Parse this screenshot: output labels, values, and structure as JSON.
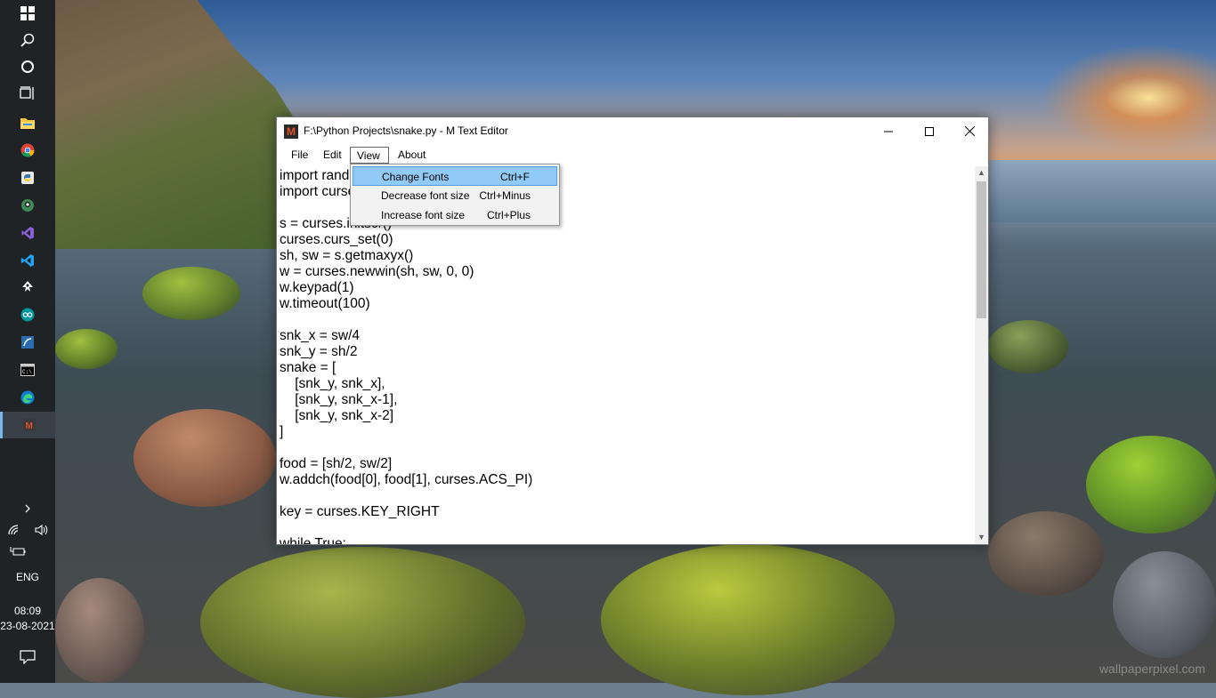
{
  "window": {
    "title": "F:\\Python Projects\\snake.py - M Text Editor",
    "app_icon_letter": "M"
  },
  "menubar": {
    "file": "File",
    "edit": "Edit",
    "view": "View",
    "about": "About"
  },
  "view_menu": [
    {
      "label": "Change Fonts",
      "shortcut": "Ctrl+F",
      "highlighted": true
    },
    {
      "label": "Decrease font size",
      "shortcut": "Ctrl+Minus",
      "highlighted": false
    },
    {
      "label": "Increase font size",
      "shortcut": "Ctrl+Plus",
      "highlighted": false
    }
  ],
  "editor": {
    "lines": [
      "import rand",
      "import curse",
      "",
      "s = curses.initscr()",
      "curses.curs_set(0)",
      "sh, sw = s.getmaxyx()",
      "w = curses.newwin(sh, sw, 0, 0)",
      "w.keypad(1)",
      "w.timeout(100)",
      "",
      "snk_x = sw/4",
      "snk_y = sh/2",
      "snake = [",
      "    [snk_y, snk_x],",
      "    [snk_y, snk_x-1],",
      "    [snk_y, snk_x-2]",
      "]",
      "",
      "food = [sh/2, sw/2]",
      "w.addch(food[0], food[1], curses.ACS_PI)",
      "",
      "key = curses.KEY_RIGHT",
      "",
      "while True:"
    ]
  },
  "taskbar": {
    "language": "ENG",
    "time": "08:09",
    "date": "23-08-2021",
    "icons": [
      "windows-start-icon",
      "search-icon",
      "cortana-icon",
      "task-view-icon",
      "file-explorer-icon",
      "chrome-icon",
      "python-idle-icon",
      "github-desktop-icon",
      "visual-studio-icon",
      "vscode-icon",
      "inkscape-icon",
      "arduino-icon",
      "app-icon",
      "command-prompt-icon",
      "edge-icon",
      "m-text-editor-icon"
    ]
  },
  "wallpaper": {
    "watermark": "wallpaperpixel.com"
  }
}
